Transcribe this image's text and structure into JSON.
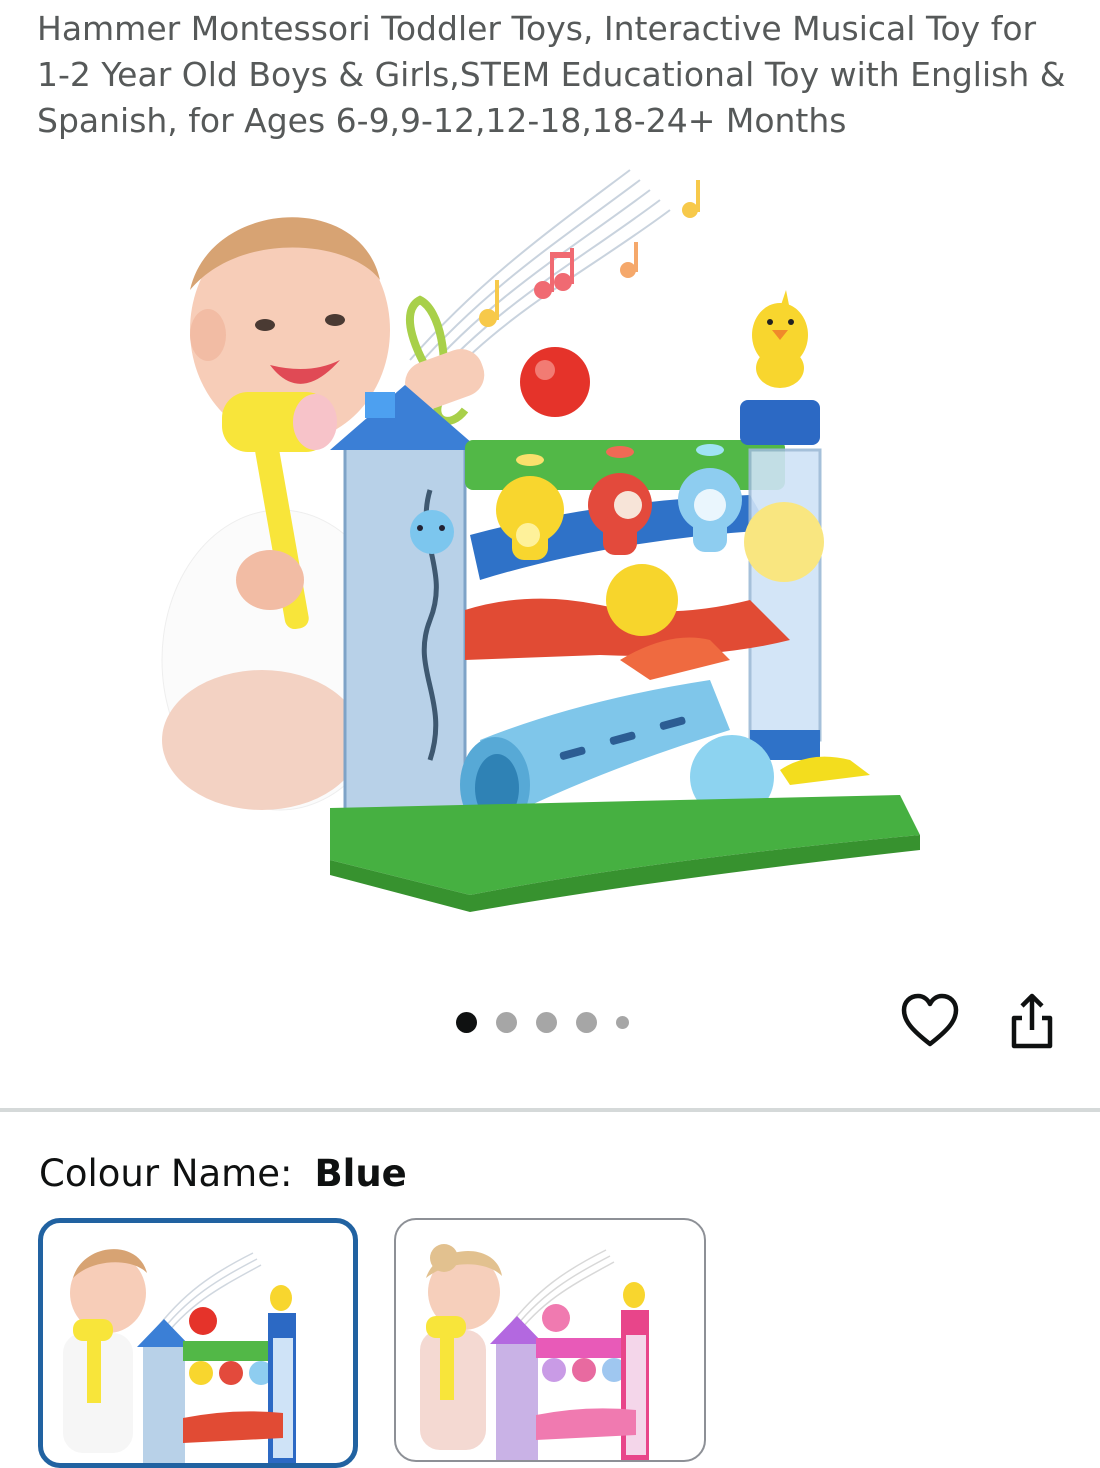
{
  "product": {
    "title": "Hammer Montessori Toddler Toys, Interactive Musical Toy for 1-2 Year Old Boys & Girls,STEM Educational Toy with English & Spanish, for Ages 6-9,9-12,12-18,18-24+ Months",
    "main_image_icon": "product-photo",
    "carousel": {
      "count": 5,
      "active": 1
    },
    "actions": {
      "wishlist_icon": "heart-icon",
      "share_icon": "share-icon"
    }
  },
  "variation": {
    "label": "Colour Name:",
    "selected_value": "Blue",
    "options": [
      {
        "name": "Blue",
        "selected": true
      },
      {
        "name": "Pink",
        "selected": false
      }
    ]
  },
  "colors": {
    "accent_border": "#2162a1",
    "muted_text": "#565959",
    "dot_inactive": "#a6a6a6",
    "dot_active": "#0f1111"
  }
}
